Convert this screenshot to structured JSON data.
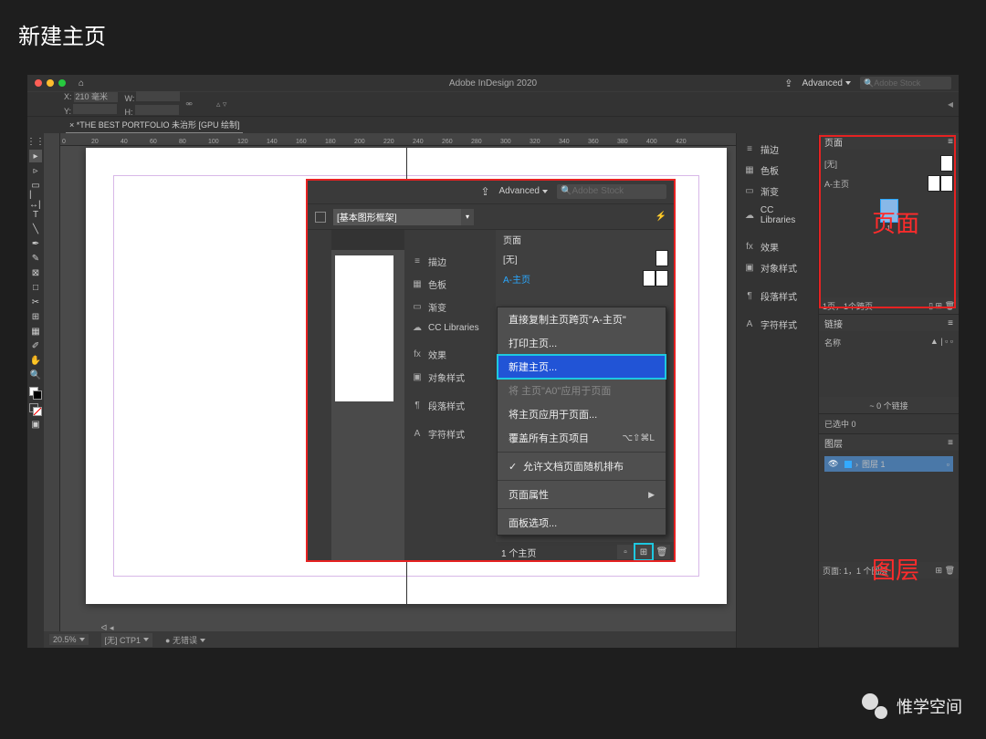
{
  "page_title": "新建主页",
  "app": {
    "title": "Adobe InDesign 2020"
  },
  "top": {
    "advanced": "Advanced",
    "search_placeholder": "Adobe Stock"
  },
  "coords": {
    "x_label": "X:",
    "x_val": "210 毫米",
    "y_label": "Y:",
    "y_val": "",
    "w_label": "W:",
    "w_val": "",
    "h_label": "H:",
    "h_val": ""
  },
  "doc_tab": "× *THE BEST PORTFOLIO 未治形 [GPU 绘制]",
  "ruler_ticks": [
    "0",
    "20",
    "40",
    "60",
    "80",
    "100",
    "120",
    "140",
    "160",
    "180",
    "200",
    "220",
    "240",
    "260",
    "280",
    "300",
    "320",
    "340",
    "360",
    "380",
    "400",
    "420"
  ],
  "status": {
    "zoom": "20.5%",
    "page_sel": "[无]   CTP1",
    "preflight": "无错误"
  },
  "side_collapsed": {
    "group1": [
      "描边",
      "色板",
      "渐变",
      "CC Libraries"
    ],
    "group2": [
      "效果",
      "对象样式"
    ],
    "group3": [
      "段落样式"
    ],
    "group4": [
      "字符样式"
    ]
  },
  "right": {
    "pages": {
      "title": "页面",
      "none": "[无]",
      "a_master": "A-主页",
      "footer": "1页，1个跨页"
    },
    "links": {
      "title": "链接",
      "name_col": "名称",
      "sel_footer": "已选中 0",
      "links_footer": "~ 0 个链接"
    },
    "layers": {
      "title": "图层",
      "layer1": "图层 1",
      "footer": "页面: 1，1 个图层"
    }
  },
  "overlay": {
    "advanced": "Advanced",
    "search_placeholder": "Adobe Stock",
    "style_dd": "[基本图形框架]",
    "side": {
      "group1": [
        "描边",
        "色板",
        "渐变",
        "CC Libraries"
      ],
      "group2": [
        "效果",
        "对象样式"
      ],
      "group3": [
        "段落样式"
      ],
      "group4": [
        "字符样式"
      ]
    },
    "pages": {
      "title": "页面",
      "none": "[无]",
      "a_master": "A-主页",
      "footer": "1 个主页"
    }
  },
  "context_menu": {
    "items": [
      {
        "label": "直接复制主页跨页\"A-主页\"",
        "type": "item"
      },
      {
        "label": "打印主页...",
        "type": "item"
      },
      {
        "label": "新建主页...",
        "type": "selected"
      },
      {
        "label": "将 主页\"A0\"应用于页面",
        "type": "disabled"
      },
      {
        "label": "将主页应用于页面...",
        "type": "item"
      },
      {
        "label": "覆盖所有主页项目",
        "shortcut": "⌥⇧⌘L",
        "type": "item"
      },
      {
        "type": "sep"
      },
      {
        "label": "允许文档页面随机排布",
        "checked": true,
        "type": "item"
      },
      {
        "type": "sep"
      },
      {
        "label": "页面属性",
        "submenu": true,
        "type": "item"
      },
      {
        "type": "sep"
      },
      {
        "label": "面板选项...",
        "type": "item"
      }
    ]
  },
  "annotations": {
    "pages": "页面",
    "layers": "图层"
  },
  "watermark": "惟学空间"
}
